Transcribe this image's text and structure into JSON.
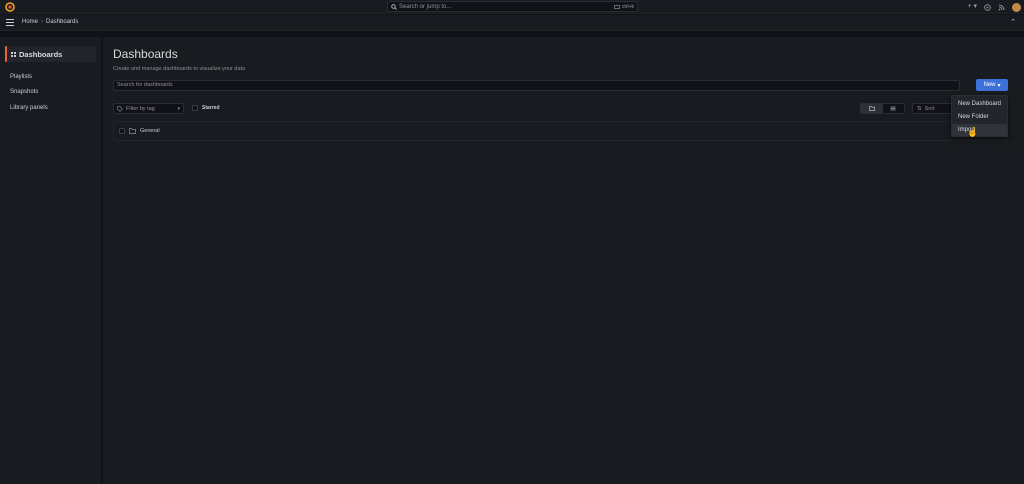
{
  "topbar": {
    "search_placeholder": "Search or jump to...",
    "shortcut": "ctrl+k",
    "add_icon": "plus-icon",
    "help_icon": "help-icon",
    "news_icon": "rss-icon"
  },
  "breadcrumb": {
    "home": "Home",
    "separator": "›",
    "current": "Dashboards"
  },
  "sidebar": {
    "active": "Dashboards",
    "items": [
      {
        "label": "Playlists"
      },
      {
        "label": "Snapshots"
      },
      {
        "label": "Library panels"
      }
    ]
  },
  "main": {
    "title": "Dashboards",
    "subtitle": "Create and manage dashboards to visualize your data",
    "search_placeholder": "Search for dashboards",
    "new_button": "New",
    "filter_by_tag": "Filter by tag",
    "starred": "Starred",
    "sort": "Sort",
    "folders": [
      {
        "label": "General"
      }
    ]
  },
  "new_menu": {
    "items": [
      {
        "label": "New Dashboard"
      },
      {
        "label": "New Folder"
      },
      {
        "label": "Import"
      }
    ]
  },
  "colors": {
    "accent": "#f55f3e",
    "primary_button": "#3d71d9",
    "background": "#111217",
    "panel": "#181b1f"
  }
}
